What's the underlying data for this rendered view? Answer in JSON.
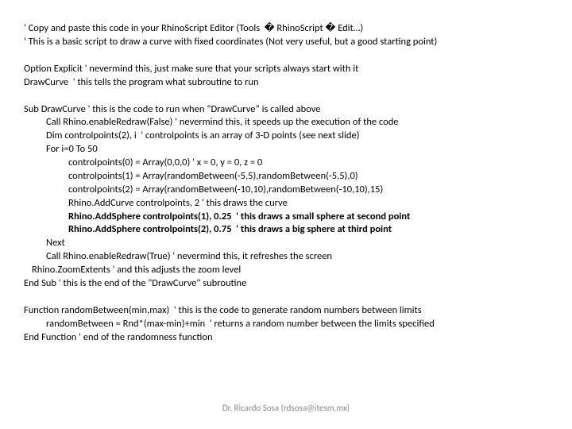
{
  "code": {
    "l01": "' Copy and paste this code in your RhinoScript Editor (Tools  � RhinoScript � Edit…)",
    "l02": "' This is a basic script to draw a curve with fixed coordinates (Not very useful, but a good starting point)",
    "l03": "Option Explicit ' nevermind this, just make sure that your scripts always start with it",
    "l04": "DrawCurve  ' this tells the program what subroutine to run",
    "l05": "Sub DrawCurve ' this is the code to run when “DrawCurve” is called above",
    "l06": "Call Rhino.enableRedraw(False) ' nevermind this, it speeds up the execution of the code",
    "l07": "Dim controlpoints(2), i  ' controlpoints is an array of 3-D points (see next slide)",
    "l08": "For i=0 To 50",
    "l09": "controlpoints(0) = Array(0,0,0) ' x = 0, y = 0, z = 0",
    "l10": "controlpoints(1) = Array(randomBetween(-5,5),randomBetween(-5,5),0)",
    "l11": "controlpoints(2) = Array(randomBetween(-10,10),randomBetween(-10,10),15)",
    "l12": "Rhino.AddCurve controlpoints, 2 ' this draws the curve",
    "l13": "Rhino.AddSphere controlpoints(1), 0.25  ' this draws a small sphere at second point",
    "l14": "Rhino.AddSphere controlpoints(2), 0.75  ' this draws a big sphere at third point",
    "l15": "Next",
    "l16": "Call Rhino.enableRedraw(True) ' nevermind this, it refreshes the screen",
    "l17": "Rhino.ZoomExtents ' and this adjusts the zoom level",
    "l18": "End Sub ' this is the end of the \"DrawCurve\" subroutine",
    "l19": "Function randomBetween(min,max)  ' this is the code to generate random numbers between limits",
    "l20": "randomBetween = Rnd*(max-min)+min  ' returns a random number between the limits specified",
    "l21": "End Function ' end of the randomness function"
  },
  "footer": "Dr. Ricardo Sosa (rdsosa@itesm.mx)"
}
